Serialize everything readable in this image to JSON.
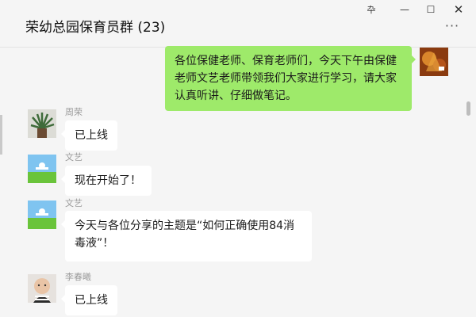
{
  "window": {
    "title": "荣幼总园保育员群 (23)",
    "controls": {
      "pin": "卆",
      "minimize": "—",
      "maximize": "☐",
      "close": "✕",
      "more": "···"
    }
  },
  "messages": [
    {
      "from": "self",
      "avatar_icon": "maple-leaf-avatar-icon",
      "text": "各位保健老师、保育老师们，今天下午由保健老师文艺老师带领我们大家进行学习，请大家认真听讲、仔细做笔记。"
    },
    {
      "from": "other",
      "sender": "周荣",
      "avatar_icon": "potted-plant-avatar-icon",
      "text": "已上线"
    },
    {
      "from": "other",
      "sender": "文艺",
      "avatar_icon": "meadow-landscape-avatar-icon",
      "text": "现在开始了！"
    },
    {
      "from": "other",
      "sender": "文艺",
      "avatar_icon": "meadow-landscape-avatar-icon",
      "text": "今天与各位分享的主题是“如何正确使用84消毒液”！"
    },
    {
      "from": "other",
      "sender": "李春曦",
      "avatar_icon": "baby-photo-avatar-icon",
      "text": "已上线"
    }
  ],
  "colors": {
    "background": "#f5f5f5",
    "self_bubble": "#9eea6a",
    "other_bubble": "#ffffff",
    "sender_name": "#9a9a9a"
  }
}
